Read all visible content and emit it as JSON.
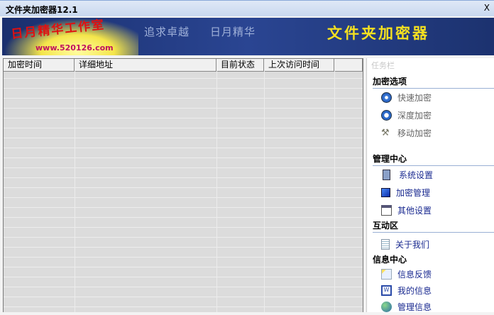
{
  "window": {
    "title": "文件夹加密器12.1",
    "close": "X"
  },
  "banner": {
    "logo_text": "日月精华工作室",
    "logo_url": "www.520126.com",
    "slogan1": "追求卓越",
    "slogan2": "日月精华",
    "app_name": "文件夹加密器"
  },
  "table": {
    "columns": [
      "加密时间",
      "详细地址",
      "目前状态",
      "上次访问时间",
      ""
    ]
  },
  "sidebar": {
    "caption": "任务栏",
    "sections": [
      {
        "title": "加密选项",
        "items": [
          "快速加密",
          "深度加密",
          "移动加密"
        ]
      },
      {
        "title": "管理中心",
        "items": [
          "系统设置",
          "加密管理",
          "其他设置"
        ]
      },
      {
        "title": "互动区",
        "items": [
          "关于我们"
        ]
      },
      {
        "title": "信息中心",
        "items": [
          "信息反馈",
          "我的信息",
          "管理信息"
        ]
      }
    ]
  }
}
